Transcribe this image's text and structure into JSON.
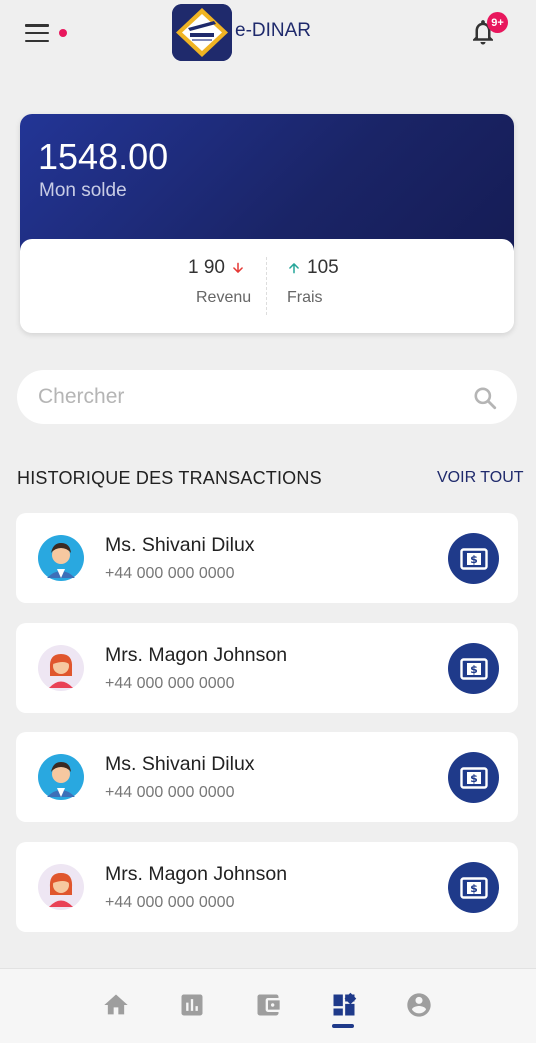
{
  "header": {
    "title": "e-DINAR",
    "notification_badge": "9+"
  },
  "balance": {
    "amount": "1548.00",
    "label": "Mon solde",
    "income": {
      "value": "1 90",
      "label": "Revenu",
      "trend": "down"
    },
    "fees": {
      "value": "105",
      "label": "Frais",
      "trend": "up"
    }
  },
  "search": {
    "placeholder": "Chercher"
  },
  "transactions": {
    "title": "HISTORIQUE DES TRANSACTIONS",
    "see_all": "VOIR TOUT",
    "items": [
      {
        "name": "Ms. Shivani Dilux",
        "phone": "+44 000 000 0000",
        "avatar": "male-avatar"
      },
      {
        "name": "Mrs. Magon Johnson",
        "phone": "+44 000 000 0000",
        "avatar": "female-avatar"
      },
      {
        "name": "Ms. Shivani Dilux",
        "phone": "+44 000 000 0000",
        "avatar": "male-avatar"
      },
      {
        "name": "Mrs. Magon Johnson",
        "phone": "+44 000 000 0000",
        "avatar": "female-avatar"
      }
    ]
  },
  "bottom_nav": {
    "items": [
      "home-icon",
      "chart-icon",
      "wallet-icon",
      "dashboard-icon",
      "account-icon"
    ],
    "active": "dashboard-icon"
  },
  "colors": {
    "primary": "#1f2a6c",
    "accent": "#e8175d",
    "action": "#1f3a8a",
    "down": "#e53935",
    "up": "#26a69a"
  }
}
